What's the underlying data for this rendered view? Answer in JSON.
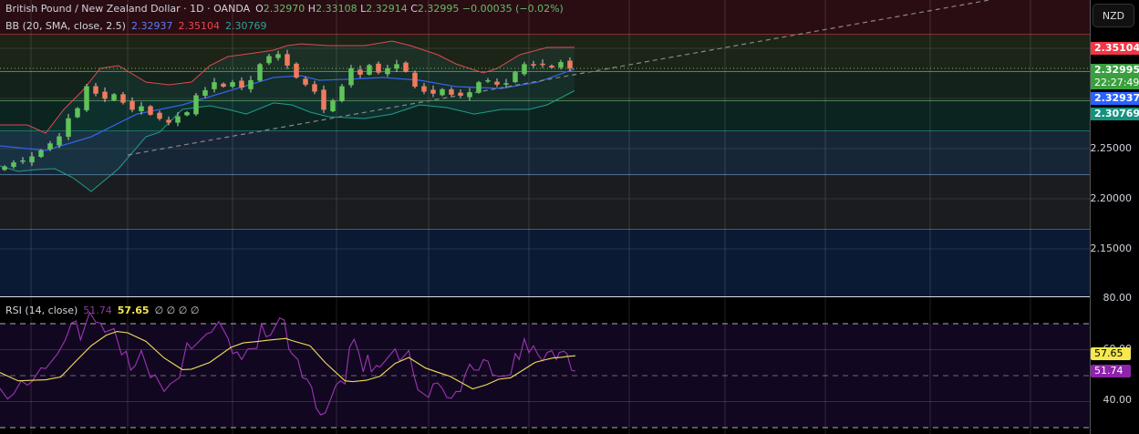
{
  "header": {
    "symbol": "British Pound / New Zealand Dollar · 1D · OANDA",
    "open_label": "O",
    "open": "2.32970",
    "high_label": "H",
    "high": "2.33108",
    "low_label": "L",
    "low": "2.32914",
    "close_label": "C",
    "close": "2.32995",
    "change": "−0.00035 (−0.02%)"
  },
  "bb_legend": {
    "label": "BB (20, SMA, close, 2.5)",
    "basis": "2.32937",
    "upper": "2.35104",
    "lower": "2.30769"
  },
  "rsi_legend": {
    "label": "RSI (14, close)",
    "rsi": "51.74",
    "ma": "57.65",
    "empty": "∅ ∅ ∅ ∅"
  },
  "currency_button": "NZD",
  "price_axis": {
    "ticks": [
      "2.25000",
      "2.20000",
      "2.15000"
    ],
    "tick_values": [
      2.25,
      2.2,
      2.15
    ],
    "labels": {
      "upper": "2.35104",
      "close": "2.32995",
      "countdown": "22:27:49",
      "basis": "2.32937",
      "lower": "2.30769"
    }
  },
  "rsi_axis": {
    "ticks": [
      "80.00",
      "60.00",
      "40.00"
    ],
    "labels": {
      "ma": "57.65",
      "rsi": "51.74"
    }
  },
  "colors": {
    "up": "#5fc35a",
    "down": "#f27a5e",
    "upper": "#e0484f",
    "basis": "#3562e8",
    "lower": "#1f9e89",
    "rsi": "#9c36b5",
    "rsi_ma": "#f0df5a"
  },
  "chart_data": [
    {
      "type": "candlestick",
      "title": "British Pound / New Zealand Dollar · 1D · OANDA",
      "ylim": [
        2.11,
        2.4
      ],
      "closes": [
        2.232,
        2.236,
        2.238,
        2.242,
        2.248,
        2.255,
        2.262,
        2.28,
        2.29,
        2.312,
        2.305,
        2.3,
        2.304,
        2.296,
        2.289,
        2.292,
        2.284,
        2.28,
        2.276,
        2.282,
        2.286,
        2.303,
        2.308,
        2.316,
        2.312,
        2.316,
        2.311,
        2.318,
        2.334,
        2.342,
        2.344,
        2.333,
        2.321,
        2.314,
        2.307,
        2.289,
        2.298,
        2.312,
        2.33,
        2.324,
        2.333,
        2.326,
        2.33,
        2.334,
        2.327,
        2.312,
        2.307,
        2.305,
        2.309,
        2.304,
        2.303,
        2.306,
        2.316,
        2.318,
        2.314,
        2.315,
        2.326,
        2.334,
        2.333,
        2.334,
        2.331,
        2.336,
        2.32995
      ],
      "bollinger": {
        "upper": [
          [
            0,
            2.2736
          ],
          [
            3,
            2.2736
          ],
          [
            5,
            2.2655
          ],
          [
            7,
            2.2891
          ],
          [
            9,
            2.3073
          ],
          [
            11,
            2.33
          ],
          [
            13,
            2.3327
          ],
          [
            16,
            2.3164
          ],
          [
            18.5,
            2.3136
          ],
          [
            21,
            2.3164
          ],
          [
            23,
            2.3327
          ],
          [
            25,
            2.3418
          ],
          [
            28,
            2.3455
          ],
          [
            30,
            2.3482
          ],
          [
            31.5,
            2.3527
          ],
          [
            33,
            2.3545
          ],
          [
            36,
            2.3527
          ],
          [
            40,
            2.3527
          ],
          [
            43,
            2.3573
          ],
          [
            45,
            2.3527
          ],
          [
            48,
            2.3436
          ],
          [
            50,
            2.3345
          ],
          [
            53,
            2.3255
          ],
          [
            54.5,
            2.33
          ],
          [
            57,
            2.3436
          ],
          [
            60,
            2.3509
          ],
          [
            63,
            2.35104
          ]
        ],
        "basis": [
          [
            0,
            2.2527
          ],
          [
            5,
            2.2482
          ],
          [
            10,
            2.2618
          ],
          [
            15,
            2.2845
          ],
          [
            20,
            2.2936
          ],
          [
            25,
            2.3073
          ],
          [
            30,
            2.3209
          ],
          [
            33,
            2.3227
          ],
          [
            35,
            2.3182
          ],
          [
            38,
            2.3191
          ],
          [
            42,
            2.3209
          ],
          [
            46,
            2.3182
          ],
          [
            50,
            2.3118
          ],
          [
            55,
            2.31
          ],
          [
            59,
            2.3164
          ],
          [
            63,
            2.32937
          ]
        ],
        "lower": [
          [
            0,
            2.2327
          ],
          [
            2,
            2.2273
          ],
          [
            4,
            2.2291
          ],
          [
            6,
            2.23
          ],
          [
            8,
            2.2209
          ],
          [
            10,
            2.2073
          ],
          [
            13,
            2.23
          ],
          [
            16,
            2.2618
          ],
          [
            17.5,
            2.2664
          ],
          [
            20,
            2.2891
          ],
          [
            23,
            2.2927
          ],
          [
            25,
            2.2891
          ],
          [
            27,
            2.2845
          ],
          [
            30,
            2.2955
          ],
          [
            32,
            2.2936
          ],
          [
            34,
            2.2864
          ],
          [
            36,
            2.2818
          ],
          [
            40,
            2.28
          ],
          [
            43,
            2.2845
          ],
          [
            46,
            2.2936
          ],
          [
            49,
            2.2909
          ],
          [
            52,
            2.2845
          ],
          [
            55,
            2.2891
          ],
          [
            58,
            2.2891
          ],
          [
            60,
            2.2936
          ],
          [
            63,
            2.30769
          ]
        ]
      },
      "zones": [
        2.3636,
        2.3264,
        2.2973,
        2.2673,
        2.2236,
        2.1691,
        2.11
      ]
    },
    {
      "type": "line",
      "title": "RSI (14, close)",
      "ylim": [
        25,
        85
      ],
      "bands": [
        70,
        50,
        30
      ],
      "rsi": [
        [
          0,
          45.1
        ],
        [
          0.83,
          41
        ],
        [
          1.5,
          43
        ],
        [
          2.33,
          48
        ],
        [
          3,
          46.3
        ],
        [
          3.5,
          47.7
        ],
        [
          4.5,
          53
        ],
        [
          5,
          52.7
        ],
        [
          6.33,
          58.5
        ],
        [
          7.17,
          63.8
        ],
        [
          7.83,
          70.2
        ],
        [
          8.33,
          71.1
        ],
        [
          8.83,
          63.8
        ],
        [
          9.83,
          74.3
        ],
        [
          10.5,
          70.6
        ],
        [
          11,
          70.2
        ],
        [
          11.5,
          66.7
        ],
        [
          12.5,
          68.1
        ],
        [
          13.33,
          58
        ],
        [
          13.83,
          59.4
        ],
        [
          14.33,
          52.1
        ],
        [
          14.83,
          53.9
        ],
        [
          15.5,
          59.7
        ],
        [
          16.5,
          49.2
        ],
        [
          17,
          50.4
        ],
        [
          18,
          43.9
        ],
        [
          18.67,
          46.8
        ],
        [
          19.67,
          49.2
        ],
        [
          20.5,
          62.6
        ],
        [
          21,
          60.3
        ],
        [
          22,
          63.8
        ],
        [
          22.67,
          66.1
        ],
        [
          23.17,
          66.7
        ],
        [
          24,
          70.8
        ],
        [
          25,
          64.4
        ],
        [
          25.5,
          58.5
        ],
        [
          26,
          59.1
        ],
        [
          26.5,
          56.2
        ],
        [
          27.17,
          60.3
        ],
        [
          28.17,
          60.5
        ],
        [
          28.67,
          69.9
        ],
        [
          29.17,
          65
        ],
        [
          29.67,
          65.6
        ],
        [
          30.67,
          72.2
        ],
        [
          31.17,
          71.4
        ],
        [
          31.67,
          60.3
        ],
        [
          32,
          58.5
        ],
        [
          32.67,
          56.2
        ],
        [
          33.17,
          49.2
        ],
        [
          33.67,
          48.6
        ],
        [
          34.17,
          45.7
        ],
        [
          34.67,
          37.5
        ],
        [
          35.17,
          34.9
        ],
        [
          35.67,
          35.7
        ],
        [
          36.33,
          41.6
        ],
        [
          36.83,
          46.3
        ],
        [
          37.33,
          48
        ],
        [
          37.83,
          46.8
        ],
        [
          38.33,
          60.9
        ],
        [
          38.83,
          64
        ],
        [
          39.33,
          59.1
        ],
        [
          39.83,
          51.5
        ],
        [
          40.33,
          58
        ],
        [
          40.73,
          51.5
        ],
        [
          41.27,
          53.9
        ],
        [
          41.67,
          53.3
        ],
        [
          42.5,
          56.8
        ],
        [
          43.33,
          60.3
        ],
        [
          43.83,
          55.6
        ],
        [
          44.83,
          59.7
        ],
        [
          45.33,
          50.9
        ],
        [
          45.83,
          44.5
        ],
        [
          46.33,
          43.3
        ],
        [
          47,
          41.6
        ],
        [
          47.5,
          46.8
        ],
        [
          48,
          47.2
        ],
        [
          48.5,
          45.1
        ],
        [
          49,
          41.6
        ],
        [
          49.5,
          41.3
        ],
        [
          50,
          43.9
        ],
        [
          50.5,
          43.9
        ],
        [
          51,
          50.4
        ],
        [
          51.5,
          54.4
        ],
        [
          52,
          52.1
        ],
        [
          52.5,
          52.1
        ],
        [
          53,
          56.2
        ],
        [
          53.5,
          55.6
        ],
        [
          54,
          50.4
        ],
        [
          54.67,
          49.8
        ],
        [
          55.33,
          49.8
        ],
        [
          56,
          50.4
        ],
        [
          56.5,
          58.5
        ],
        [
          56.93,
          56.2
        ],
        [
          57.5,
          64.2
        ],
        [
          58,
          58.8
        ],
        [
          58.5,
          61.5
        ],
        [
          59,
          58
        ],
        [
          59.5,
          55.6
        ],
        [
          60,
          58.9
        ],
        [
          60.5,
          59.6
        ],
        [
          61,
          56.2
        ],
        [
          61.33,
          58.9
        ],
        [
          61.83,
          59.4
        ],
        [
          62.17,
          58.5
        ],
        [
          62.67,
          52.1
        ],
        [
          63.1,
          51.74
        ]
      ],
      "rsi_ma": [
        [
          0,
          51.2
        ],
        [
          2,
          48
        ],
        [
          5,
          48.4
        ],
        [
          6.67,
          49.5
        ],
        [
          8.33,
          55.6
        ],
        [
          10,
          61.5
        ],
        [
          11.67,
          65.6
        ],
        [
          12.83,
          67
        ],
        [
          14,
          66.5
        ],
        [
          16,
          63.2
        ],
        [
          18,
          56.8
        ],
        [
          20,
          52.3
        ],
        [
          21,
          52.5
        ],
        [
          23,
          55.1
        ],
        [
          25.33,
          60.9
        ],
        [
          26.67,
          62.6
        ],
        [
          28.33,
          63.2
        ],
        [
          29.33,
          63.6
        ],
        [
          31.33,
          64.3
        ],
        [
          32,
          63.5
        ],
        [
          34,
          61.5
        ],
        [
          35.67,
          55
        ],
        [
          37.83,
          48
        ],
        [
          38.67,
          47.7
        ],
        [
          40.17,
          48.2
        ],
        [
          41.67,
          49.8
        ],
        [
          43.33,
          54.7
        ],
        [
          44.83,
          57
        ],
        [
          46.67,
          52.9
        ],
        [
          48,
          51.3
        ],
        [
          49.33,
          49.8
        ],
        [
          51.83,
          44.9
        ],
        [
          53.33,
          46.5
        ],
        [
          54.67,
          48.6
        ],
        [
          56,
          49.2
        ],
        [
          57.33,
          52.1
        ],
        [
          58.67,
          55.1
        ],
        [
          59.67,
          56
        ],
        [
          60.67,
          56.8
        ],
        [
          61.67,
          57.1
        ],
        [
          62.17,
          57.4
        ],
        [
          63.1,
          57.65
        ]
      ]
    }
  ]
}
